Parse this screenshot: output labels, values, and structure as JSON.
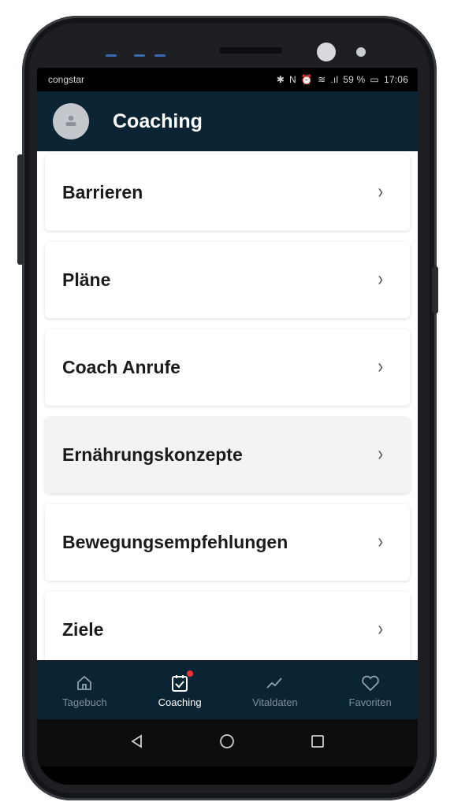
{
  "status_bar": {
    "carrier": "congstar",
    "icons_text": "✱ 🄽 ⏰ ᯤ .ıl 59 % ▭",
    "battery": "59 %",
    "time": "17:06"
  },
  "header": {
    "title": "Coaching",
    "avatar_icon": "user-avatar-icon"
  },
  "menu_items": [
    {
      "label": "Barrieren"
    },
    {
      "label": "Pläne"
    },
    {
      "label": "Coach Anrufe"
    },
    {
      "label": "Ernährungskonzepte"
    },
    {
      "label": "Bewegungsempfehlungen"
    },
    {
      "label": "Ziele"
    }
  ],
  "tabs": [
    {
      "label": "Tagebuch",
      "icon": "home-icon"
    },
    {
      "label": "Coaching",
      "icon": "checklist-icon",
      "active": true
    },
    {
      "label": "Vitaldaten",
      "icon": "trend-icon"
    },
    {
      "label": "Favoriten",
      "icon": "heart-icon"
    }
  ],
  "colors": {
    "header_bg": "#0b2433",
    "badge": "#e33333"
  }
}
